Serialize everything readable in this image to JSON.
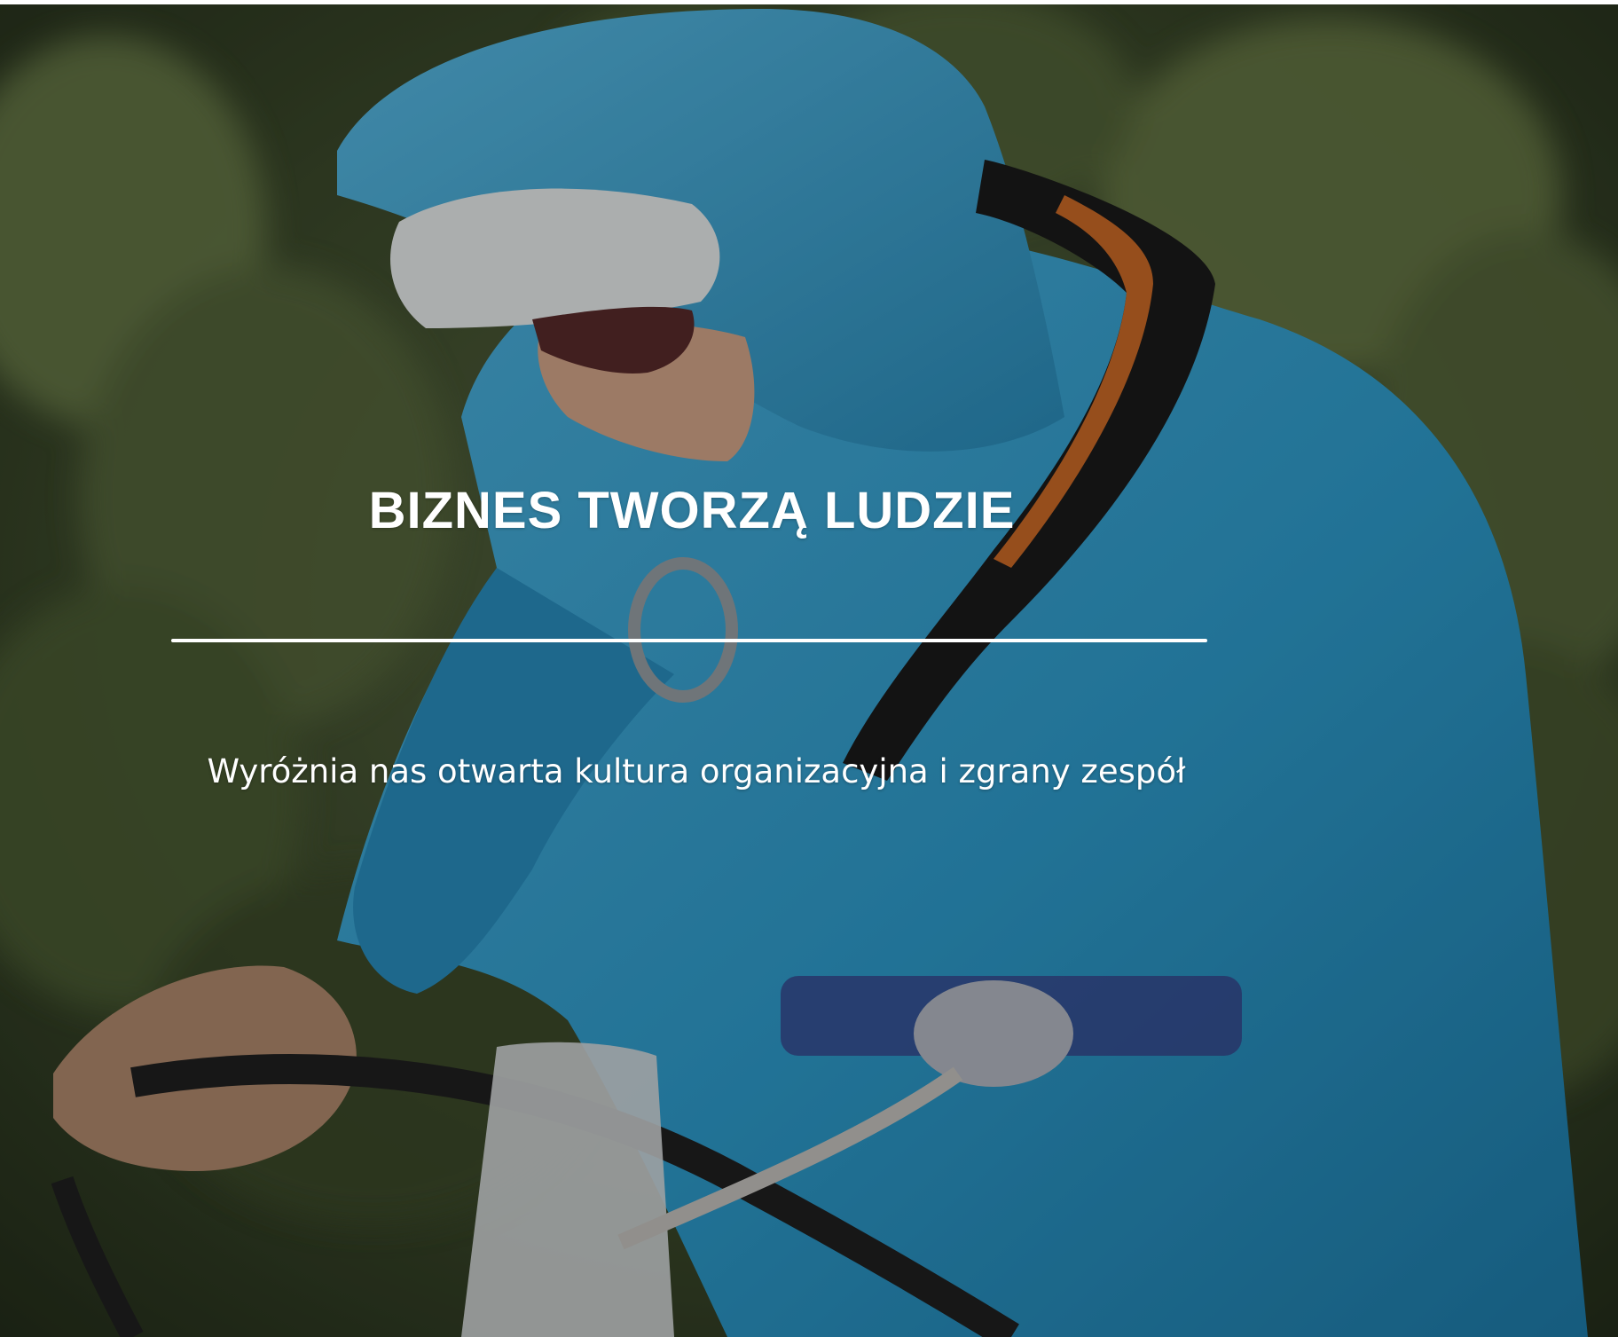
{
  "hero": {
    "title": "BIZNES TWORZĄ LUDZIE",
    "subtitle": "Wyróżnia nas otwarta kultura organizacyjna i zgrany zespół",
    "background_image": "rope-access-worker-photo"
  },
  "colors": {
    "text": "#ffffff",
    "divider": "#ffffff",
    "jacket_blue": "#2f9fd0",
    "foliage_green": "#4a5a33"
  }
}
